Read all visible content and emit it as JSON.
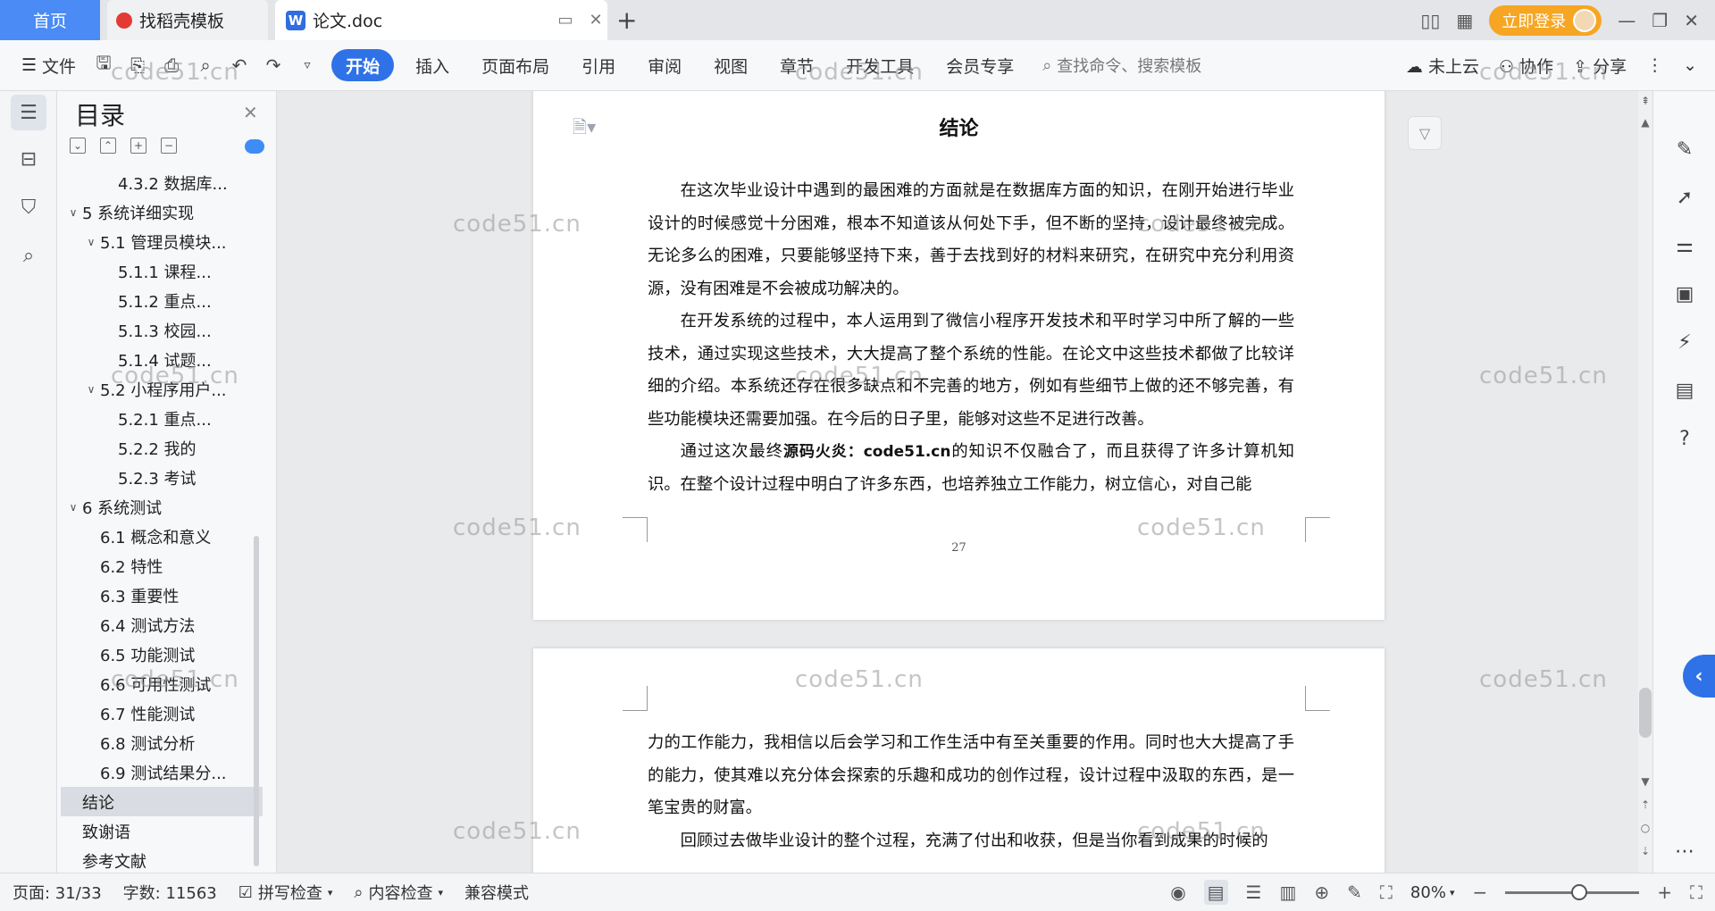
{
  "tabs": {
    "home": "首页",
    "find_template": "找稻壳模板",
    "doc_title": "论文.doc",
    "wps_logo": "W",
    "new_tab": "+"
  },
  "topbar": {
    "login": "立即登录"
  },
  "ribbon": {
    "file": "文件",
    "menus": [
      "开始",
      "插入",
      "页面布局",
      "引用",
      "审阅",
      "视图",
      "章节",
      "开发工具",
      "会员专享"
    ],
    "search_placeholder": "查找命令、搜索模板",
    "cloud": "未上云",
    "collab": "协作",
    "share": "分享"
  },
  "toc": {
    "title": "目录",
    "items": [
      {
        "label": "4.3.2 数据库...",
        "level": 3
      },
      {
        "label": "5 系统详细实现",
        "level": 1,
        "chev": true
      },
      {
        "label": "5.1  管理员模块...",
        "level": 2,
        "chev": true
      },
      {
        "label": "5.1.1  课程...",
        "level": 3
      },
      {
        "label": "5.1.2  重点...",
        "level": 3
      },
      {
        "label": "5.1.3  校园...",
        "level": 3
      },
      {
        "label": "5.1.4  试题...",
        "level": 3
      },
      {
        "label": "5.2  小程序用户...",
        "level": 2,
        "chev": true
      },
      {
        "label": "5.2.1  重点...",
        "level": 3
      },
      {
        "label": "5.2.2  我的",
        "level": 3
      },
      {
        "label": "5.2.3  考试",
        "level": 3
      },
      {
        "label": "6 系统测试",
        "level": 1,
        "chev": true
      },
      {
        "label": "6.1 概念和意义",
        "level": 2
      },
      {
        "label": "6.2 特性",
        "level": 2
      },
      {
        "label": "6.3 重要性",
        "level": 2
      },
      {
        "label": "6.4 测试方法",
        "level": 2
      },
      {
        "label": "6.5  功能测试",
        "level": 2
      },
      {
        "label": "6.6 可用性测试",
        "level": 2
      },
      {
        "label": "6.7 性能测试",
        "level": 2
      },
      {
        "label": "6.8 测试分析",
        "level": 2
      },
      {
        "label": "6.9 测试结果分...",
        "level": 2
      },
      {
        "label": "结论",
        "level": 1,
        "selected": true
      },
      {
        "label": "致谢语",
        "level": 1
      },
      {
        "label": "参考文献",
        "level": 1
      }
    ]
  },
  "document": {
    "heading": "结论",
    "p1": "在这次毕业设计中遇到的最困难的方面就是在数据库方面的知识，在刚开始进行毕业设计的时候感觉十分困难，根本不知道该从何处下手，但不断的坚持，设计最终被完成。无论多么的困难，只要能够坚持下来，善于去找到好的材料来研究，在研究中充分利用资源，没有困难是不会被成功解决的。",
    "p2": "在开发系统的过程中，本人运用到了微信小程序开发技术和平时学习中所了解的一些技术，通过实现这些技术，大大提高了整个系统的性能。在论文中这些技术都做了比较详细的介绍。本系统还存在很多缺点和不完善的地方，例如有些细节上做的还不够完善，有些功能模块还需要加强。在今后的日子里，能够对这些不足进行改善。",
    "p3_a": "通过这次最终",
    "p3_wm": "源码火炎：code51.cn",
    "p3_b": "的知识不仅融合了，而且获得了许多计算机知识。在整个设计过程中明白了许多东西，也培养独立工作能力，树立信心，对自己能",
    "page_number": "27",
    "p4": "力的工作能力，我相信以后会学习和工作生活中有至关重要的作用。同时也大大提高了手的能力，使其难以充分体会探索的乐趣和成功的创作过程，设计过程中汲取的东西，是一笔宝贵的财富。",
    "p5": "回顾过去做毕业设计的整个过程，充满了付出和收获，但是当你看到成果的时候的"
  },
  "watermark": "code51.cn",
  "status": {
    "page": "页面: 31/33",
    "words": "字数: 11563",
    "spellcheck": "拼写检查",
    "content_check": "内容检查",
    "compat": "兼容模式",
    "zoom": "80%"
  },
  "colors": {
    "accent": "#2f72e8",
    "home_tab": "#4a8bf5",
    "login": "#f6a623"
  }
}
